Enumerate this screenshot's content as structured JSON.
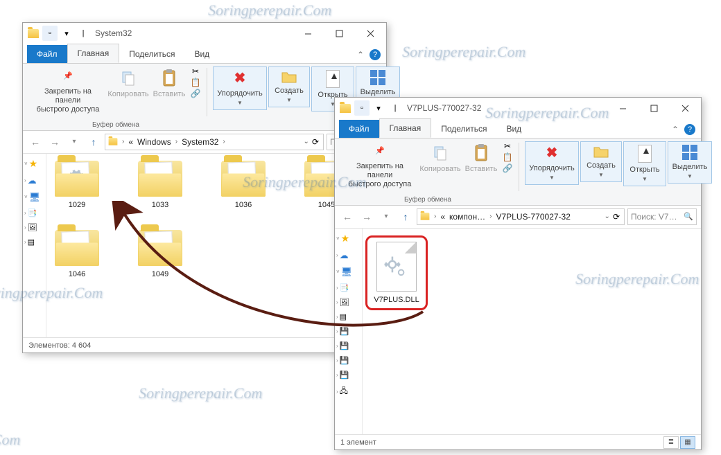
{
  "watermarks": [
    "Soringperepair.Com",
    "Soringperepair.Com",
    "Soringperepair.Com",
    "Soringperepair.Com",
    "Soringperepair.Com",
    "Soringperepair.Com",
    "Soringperepair.Com",
    "ir.Com"
  ],
  "common": {
    "ribbon_tabs": {
      "file": "Файл",
      "home": "Главная",
      "share": "Поделиться",
      "view": "Вид"
    },
    "ribbon": {
      "pin": "Закрепить на панели\nбыстрого доступа",
      "copy": "Копировать",
      "paste": "Вставить",
      "clipboard_group": "Буфер обмена",
      "organize": "Упорядочить",
      "new": "Создать",
      "open": "Открыть",
      "select": "Выделить"
    }
  },
  "win1": {
    "title": "System32",
    "breadcrumbs": [
      "«",
      "Windows",
      "System32"
    ],
    "search_placeholder": "Пои",
    "folders": [
      "1029",
      "1033",
      "1036",
      "1045",
      "1046",
      "1049"
    ],
    "status_items": "Элементов: 4 604"
  },
  "win2": {
    "title": "V7PLUS-770027-32",
    "breadcrumbs": [
      "«",
      "компон…",
      "V7PLUS-770027-32"
    ],
    "search_placeholder": "Поиск: V7…",
    "file": "V7PLUS.DLL",
    "status_items": "1 элемент"
  }
}
